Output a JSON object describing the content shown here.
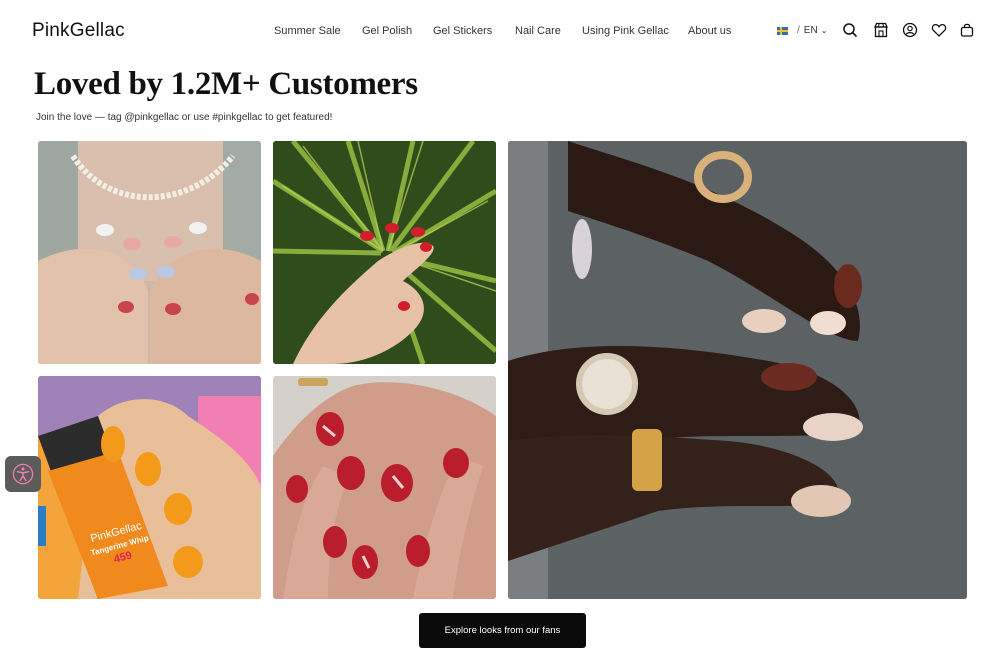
{
  "brand": {
    "logo_text": "PinkGellac"
  },
  "nav": {
    "items": [
      {
        "label": "Summer Sale"
      },
      {
        "label": "Gel Polish"
      },
      {
        "label": "Gel Stickers"
      },
      {
        "label": "Nail Care"
      },
      {
        "label": "Using Pink Gellac"
      },
      {
        "label": "About us"
      }
    ]
  },
  "locale": {
    "language": "EN",
    "separator": "/",
    "flag": "sweden-flag-icon"
  },
  "header_icons": [
    "search-icon",
    "store-icon",
    "account-icon",
    "heart-icon",
    "bag-icon"
  ],
  "hero": {
    "title": "Loved by 1.2M+ Customers",
    "subtitle": "Join the love — tag @pinkgellac or use #pinkgellac to get featured!"
  },
  "gallery": {
    "tiles": [
      {
        "id": "tile-1",
        "subject": "hands with pearl necklace and patterned manicure"
      },
      {
        "id": "tile-2",
        "subject": "hand with red nails over palm leaves"
      },
      {
        "id": "tile-3",
        "subject": "hands with rings, heart watch and nail art"
      },
      {
        "id": "tile-4",
        "subject": "hand holding orange gel polish bottle"
      },
      {
        "id": "tile-5",
        "subject": "hands with red and white heart nail art"
      }
    ],
    "bottle_label": {
      "brand": "PinkGellac",
      "shade_name": "Tangerine Whip",
      "shade_number": "459"
    }
  },
  "cta": {
    "label": "Explore looks from our fans"
  },
  "colors": {
    "accent": "#0b0b0b",
    "background": "#ffffff",
    "text": "#111111"
  }
}
